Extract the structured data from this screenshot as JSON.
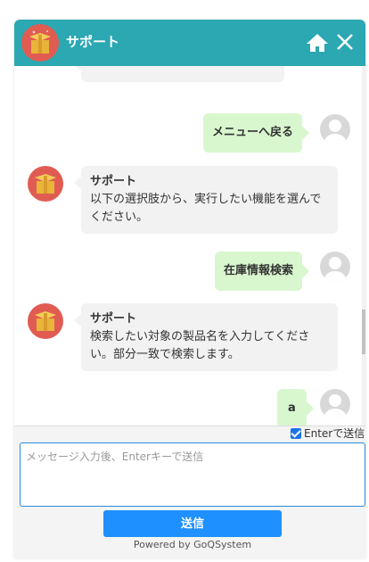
{
  "header": {
    "title": "サポート"
  },
  "messages": [
    {
      "sender": "user",
      "text": "メニューへ戻る"
    },
    {
      "sender": "bot",
      "name": "サポート",
      "lines": [
        "以下の選択肢から、実行したい機能を選んで",
        "ください。"
      ]
    },
    {
      "sender": "user",
      "text": "在庫情報検索"
    },
    {
      "sender": "bot",
      "name": "サポート",
      "lines": [
        "検索したい対象の製品名を入力してくださ",
        "い。部分一致で検索します。"
      ]
    },
    {
      "sender": "user",
      "text": "a"
    }
  ],
  "composer": {
    "enter_to_send_label": "Enterで送信",
    "enter_to_send_checked": true,
    "placeholder": "メッセージ入力後、Enterキーで送信",
    "send_label": "送信",
    "powered_by": "Powered by GoQSystem"
  },
  "colors": {
    "header": "#2ba8b2",
    "user_bubble": "#d9f7cf",
    "bot_bubble": "#f2f2f2",
    "send_button": "#1e90ff"
  },
  "icons": [
    "home-icon",
    "close-icon",
    "bot-avatar-icon",
    "user-avatar-icon",
    "checkbox-checked-icon"
  ]
}
